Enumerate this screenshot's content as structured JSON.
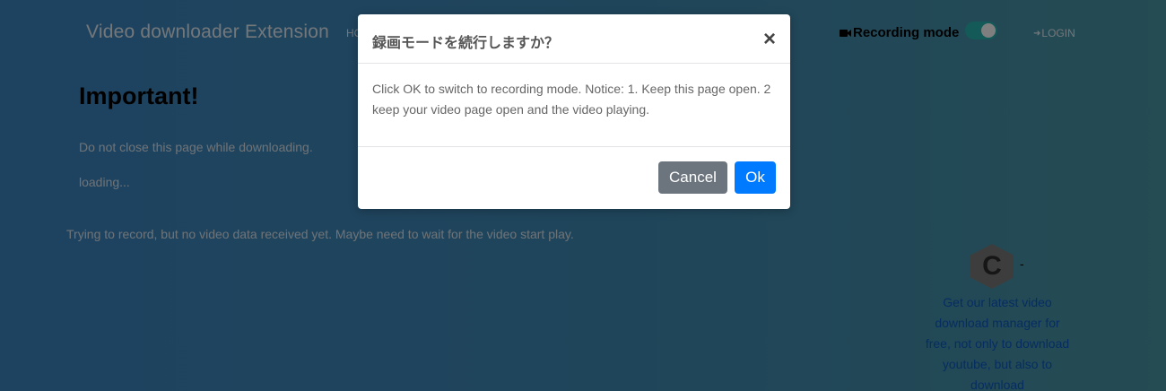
{
  "navbar": {
    "brand": "Video downloader Extension",
    "home_partial": "HO",
    "recording_label": "Recording mode",
    "recording_enabled": true,
    "login_label": "LOGIN"
  },
  "content": {
    "heading": "Important!",
    "notice": "Do not close this page while downloading.",
    "loading": "loading...",
    "record_message": "Trying to record, but no video data received yet. Maybe need to wait for the video start play."
  },
  "promo": {
    "logo_letter": "C",
    "dash": "-",
    "text": "Get our latest video download manager for free, not only to download youtube, but also to download"
  },
  "modal": {
    "title": "録画モードを続行しますか？",
    "close": "×",
    "body": "Click OK to switch to recording mode. Notice: 1. Keep this page open. 2 keep your video page open and the video playing.",
    "cancel_label": "Cancel",
    "ok_label": "Ok"
  },
  "colors": {
    "overlay": "#2a5f86",
    "toggle_on": "#27b4b0",
    "cancel_button": "#6c757d",
    "ok_button": "#007bff",
    "promo_link": "#0a5bc4"
  },
  "icons": [
    "video-camera-icon",
    "sign-in-icon",
    "close-icon",
    "hexagon-c-logo"
  ]
}
